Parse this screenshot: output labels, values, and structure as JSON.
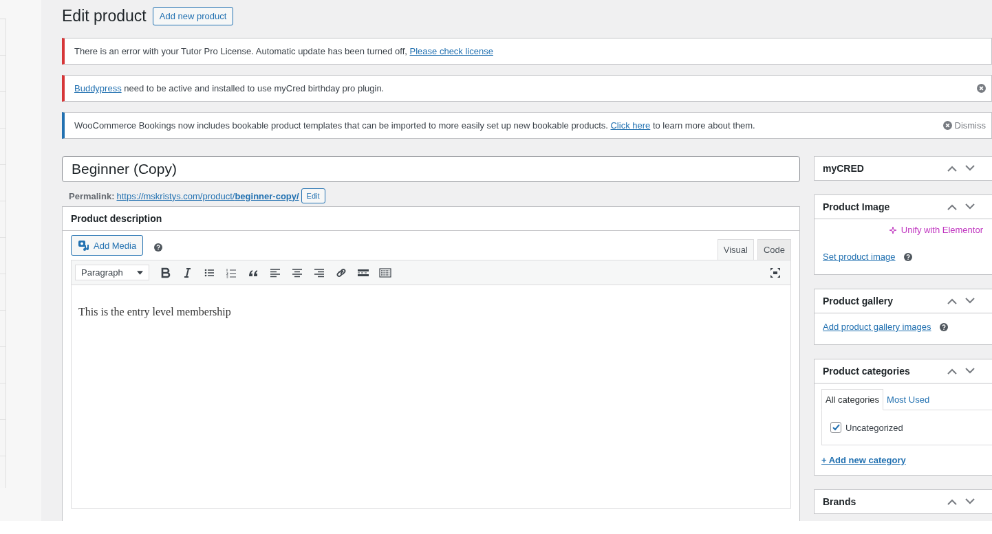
{
  "page_title": "Edit product",
  "add_new_button": "Add new product",
  "notices": [
    {
      "kind": "error",
      "before": "There is an error with your Tutor Pro License. Automatic update has been turned off, ",
      "link": "Please check license",
      "close": false
    },
    {
      "kind": "error",
      "link": "Buddypress",
      "after": " need to be active and installed to use myCred birthday pro plugin.",
      "close": true
    },
    {
      "kind": "info",
      "before": "WooCommerce Bookings now includes bookable product templates that can be imported to more easily set up new bookable products. ",
      "link": "Click here",
      "after": " to learn more about them.",
      "close": false,
      "dismiss": "Dismiss"
    }
  ],
  "title_field": {
    "value": "Beginner (Copy)"
  },
  "permalink": {
    "label": "Permalink:",
    "url_base": "https://mskristys.com/product/",
    "slug": "beginner-copy/",
    "edit_button": "Edit"
  },
  "description": {
    "heading": "Product description",
    "add_media": "Add Media",
    "tabs": [
      {
        "label": "Visual",
        "selected": true
      },
      {
        "label": "Code",
        "selected": false
      }
    ],
    "format_select": "Paragraph",
    "content": "This is the entry level membership"
  },
  "sidebar": [
    {
      "kind": "empty",
      "title": "myCRED"
    },
    {
      "kind": "image",
      "title": "Product Image",
      "elementor": "Unify with Elementor",
      "link": "Set product image"
    },
    {
      "kind": "gallery",
      "title": "Product gallery",
      "link": "Add product gallery images"
    },
    {
      "kind": "categories",
      "title": "Product categories",
      "tabs": [
        {
          "label": "All categories",
          "selected": true
        },
        {
          "label": "Most Used",
          "selected": false
        }
      ],
      "items": [
        {
          "label": "Uncategorized",
          "checked": true
        }
      ],
      "link": "+ Add new category"
    },
    {
      "kind": "empty",
      "title": "Brands"
    }
  ]
}
